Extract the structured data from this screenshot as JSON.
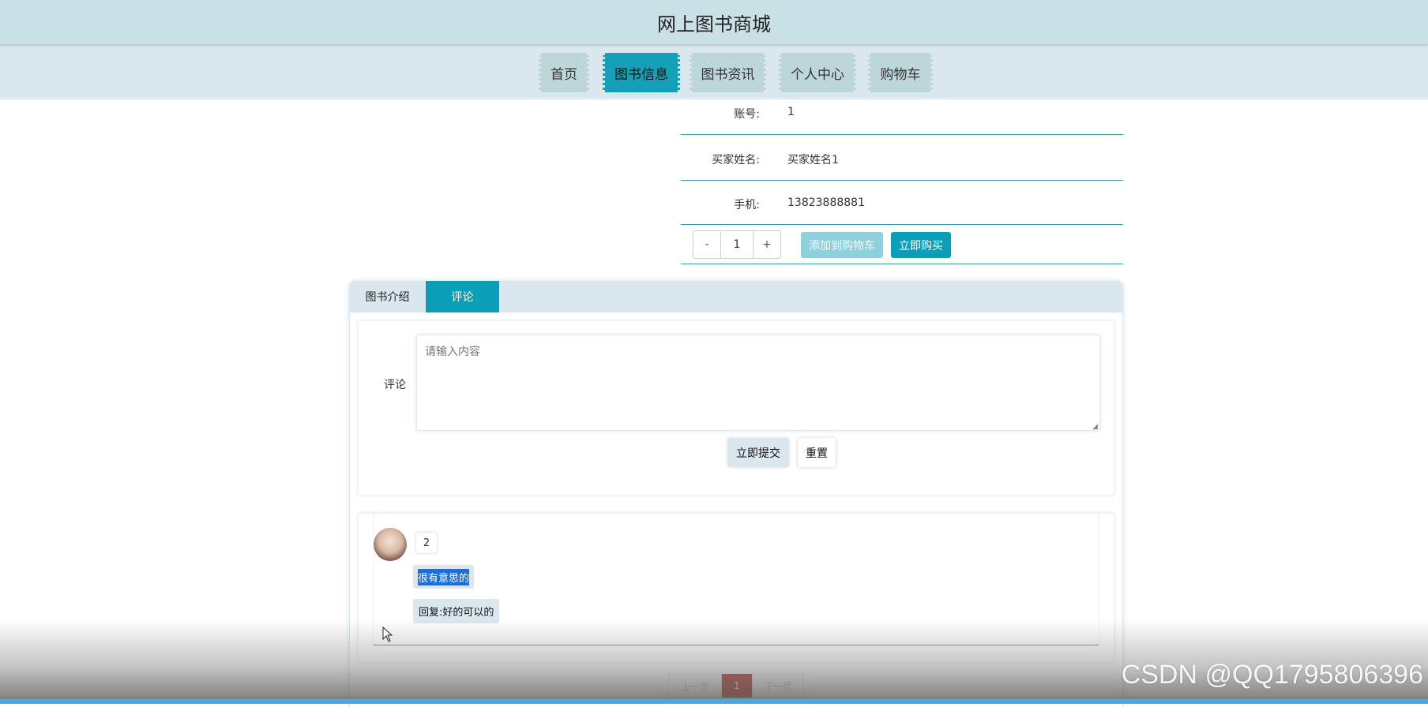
{
  "header": {
    "title": "网上图书商城"
  },
  "nav": {
    "items": [
      {
        "label": "首页"
      },
      {
        "label": "图书信息"
      },
      {
        "label": "图书资讯"
      },
      {
        "label": "个人中心"
      },
      {
        "label": "购物车"
      }
    ],
    "active_index": 1
  },
  "info": {
    "rows": [
      {
        "label": "账号:",
        "value": "1"
      },
      {
        "label": "买家姓名:",
        "value": "买家姓名1"
      },
      {
        "label": "手机:",
        "value": "13823888881"
      }
    ]
  },
  "purchase": {
    "decrement": "-",
    "quantity": "1",
    "increment": "+",
    "add_to_cart": "添加到购物车",
    "buy_now": "立即购买"
  },
  "tabs": {
    "items": [
      {
        "label": "图书介绍"
      },
      {
        "label": "评论"
      }
    ],
    "active_index": 1
  },
  "comment_form": {
    "label": "评论",
    "placeholder": "请输入内容",
    "value": "",
    "submit_label": "立即提交",
    "reset_label": "重置"
  },
  "comments": [
    {
      "user": "2",
      "text": "很有意思的",
      "reply": "回复:好的可以的"
    }
  ],
  "pagination": {
    "prev": "上一页",
    "current": "1",
    "next": "下一页"
  },
  "watermark": "CSDN @QQ1795806396",
  "colors": {
    "header_bg": "#c9e0e6",
    "nav_bg": "#dae7ef",
    "accent": "#0a9fb8",
    "page_active": "#a6150d"
  }
}
